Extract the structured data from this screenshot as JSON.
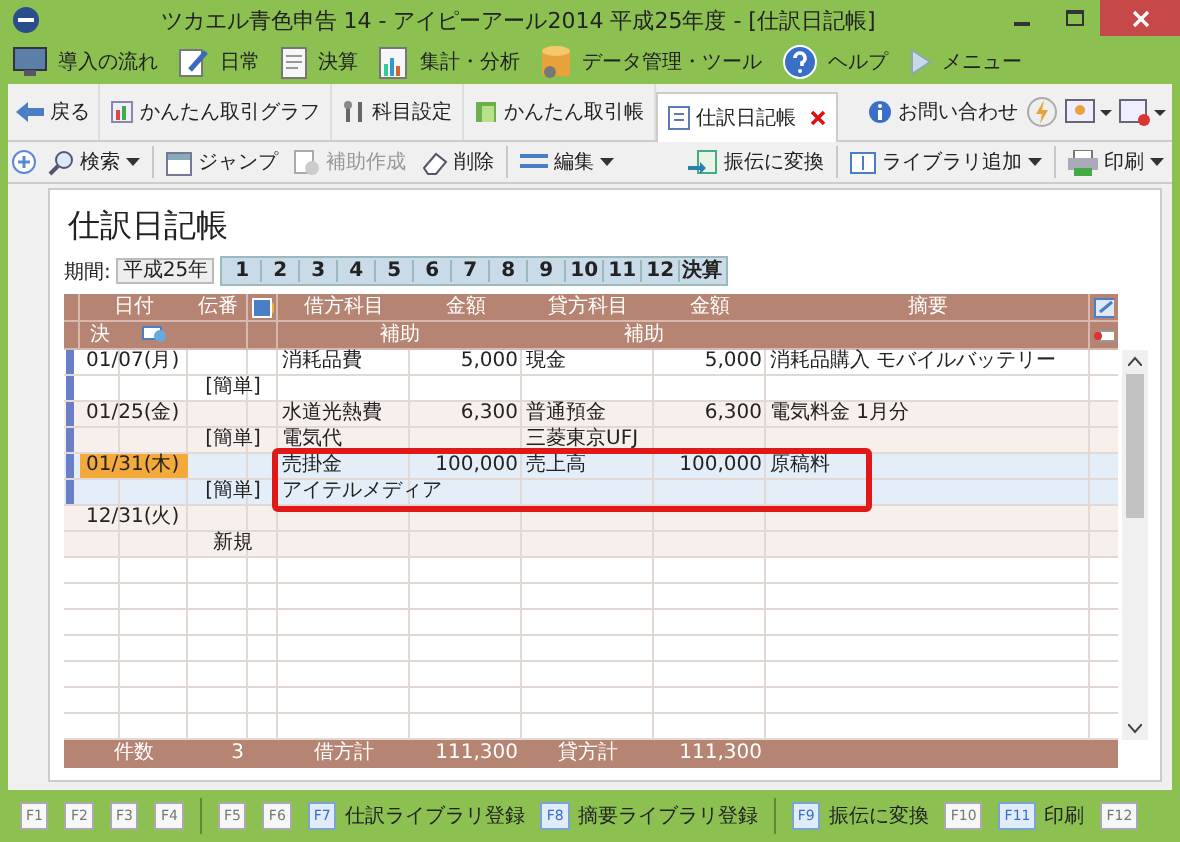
{
  "window": {
    "title": "ツカエル青色申告 14 - アイピーアール2014 平成25年度 - [仕訳日記帳]"
  },
  "menu": [
    {
      "label": "導入の流れ",
      "kind": "monitor"
    },
    {
      "label": "日常",
      "kind": "pen"
    },
    {
      "label": "決算",
      "kind": "doc"
    },
    {
      "label": "集計・分析",
      "kind": "chart"
    },
    {
      "label": "データ管理・ツール",
      "kind": "db"
    },
    {
      "label": "ヘルプ",
      "kind": "help"
    },
    {
      "label": "メニュー",
      "kind": "play"
    }
  ],
  "back": {
    "label": "戻る"
  },
  "tabs": [
    {
      "label": "かんたん取引グラフ",
      "kind": "graph",
      "selected": false
    },
    {
      "label": "科目設定",
      "kind": "tools",
      "selected": false
    },
    {
      "label": "かんたん取引帳",
      "kind": "book",
      "selected": false
    },
    {
      "label": "仕訳日記帳",
      "kind": "doc",
      "selected": true
    }
  ],
  "contact": {
    "label": "お問い合わせ"
  },
  "toolbar": [
    {
      "label": "検索",
      "kind": "search",
      "disabled": false,
      "dropdown": true
    },
    {
      "label": "ジャンプ",
      "kind": "calendar",
      "disabled": false,
      "dropdown": false
    },
    {
      "label": "補助作成",
      "kind": "add",
      "disabled": true,
      "dropdown": false
    },
    {
      "label": "削除",
      "kind": "erase",
      "disabled": false,
      "dropdown": false
    },
    {
      "label": "編集",
      "kind": "list",
      "disabled": false,
      "dropdown": true
    }
  ],
  "toolbar_right": [
    {
      "label": "振伝に変換",
      "kind": "convert",
      "dropdown": false
    },
    {
      "label": "ライブラリ追加",
      "kind": "library",
      "dropdown": true
    },
    {
      "label": "印刷",
      "kind": "print",
      "dropdown": true
    }
  ],
  "page_title": "仕訳日記帳",
  "period": {
    "label": "期間:",
    "year": "平成25年",
    "months": [
      "1",
      "2",
      "3",
      "4",
      "5",
      "6",
      "7",
      "8",
      "9",
      "10",
      "11",
      "12"
    ],
    "closing": "決算"
  },
  "header": {
    "date": "日付",
    "slip": "伝番",
    "debit": "借方科目",
    "debit_amount": "金額",
    "credit": "貸方科目",
    "credit_amount": "金額",
    "memo": "摘要",
    "closing": "決",
    "sub": "補助",
    "sub2": "補助"
  },
  "entries": [
    {
      "date": "01/07(月)",
      "selected": false,
      "type": "[簡単]",
      "debit": "消耗品費",
      "debit_amount": "5,000",
      "credit": "現金",
      "credit_amount": "5,000",
      "memo": "消耗品購入  モバイルバッテリー"
    },
    {
      "date": "01/25(金)",
      "selected": false,
      "type": "[簡単]",
      "debit": "水道光熱費",
      "debit_sub": "電気代",
      "debit_amount": "6,300",
      "credit": "普通預金",
      "credit_sub": "三菱東京UFJ",
      "credit_amount": "6,300",
      "memo": "電気料金 1月分"
    },
    {
      "date": "01/31(木)",
      "selected": true,
      "type": "[簡単]",
      "debit": "売掛金",
      "debit_sub": "アイテルメディア",
      "debit_amount": "100,000",
      "credit": "売上高",
      "credit_amount": "100,000",
      "memo": "原稿料"
    }
  ],
  "new_row": {
    "date": "12/31(火)",
    "label": "新規"
  },
  "footer": {
    "count_label": "件数",
    "count": "3",
    "debit_label": "借方計",
    "debit_total": "111,300",
    "credit_label": "貸方計",
    "credit_total": "111,300"
  },
  "function_key_groups": [
    [
      {
        "key": "F1",
        "active": false
      },
      {
        "key": "F2",
        "active": false
      },
      {
        "key": "F3",
        "active": false
      },
      {
        "key": "F4",
        "active": false
      }
    ],
    [
      {
        "key": "F5",
        "active": false
      },
      {
        "key": "F6",
        "active": false
      },
      {
        "key": "F7",
        "label": "仕訳ライブラリ登録",
        "active": true
      },
      {
        "key": "F8",
        "label": "摘要ライブラリ登録",
        "active": true
      }
    ],
    [
      {
        "key": "F9",
        "label": "振伝に変換",
        "active": true
      },
      {
        "key": "F10",
        "active": false
      },
      {
        "key": "F11",
        "label": "印刷",
        "active": true
      },
      {
        "key": "F12",
        "active": false
      }
    ]
  ]
}
